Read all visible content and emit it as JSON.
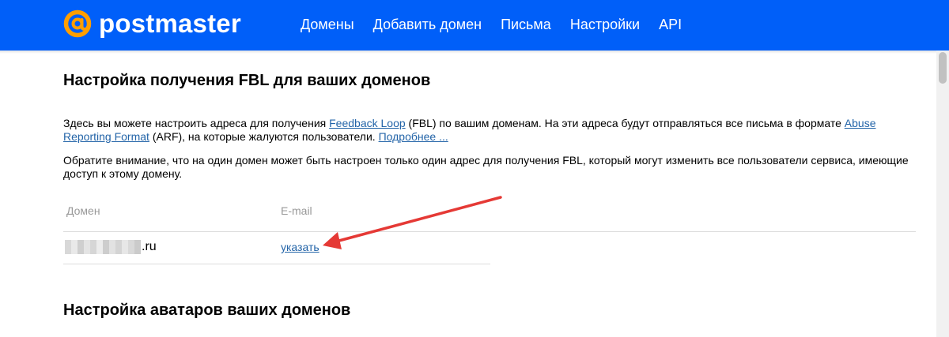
{
  "header": {
    "logo_text": "postmaster",
    "nav": [
      "Домены",
      "Добавить домен",
      "Письма",
      "Настройки",
      "API"
    ]
  },
  "fbl_section": {
    "title": "Настройка получения FBL для ваших доменов",
    "para1": {
      "t1": "Здесь вы можете настроить адреса для получения ",
      "link_feedback": "Feedback Loop",
      "t2": " (FBL) по вашим доменам. На эти адреса будут отправляться все письма в формате ",
      "link_arf": "Abuse Reporting Format",
      "t3": " (ARF), на которые жалуются пользователи. ",
      "link_more": "Подробнее ..."
    },
    "para2": "Обратите внимание, что на один домен может быть настроен только один адрес для получения FBL, который могут изменить все пользователи сервиса, имеющие доступ к этому домену.",
    "table": {
      "headers": {
        "domain": "Домен",
        "email": "E-mail"
      },
      "rows": [
        {
          "domain_suffix": ".ru",
          "email_link": "указать"
        }
      ]
    }
  },
  "avatars_section": {
    "title": "Настройка аватаров ваших доменов"
  },
  "colors": {
    "header_bg": "#005ff9",
    "logo_accent": "#ff9e00",
    "link": "#2364a8",
    "annotation_arrow": "#e53935"
  }
}
